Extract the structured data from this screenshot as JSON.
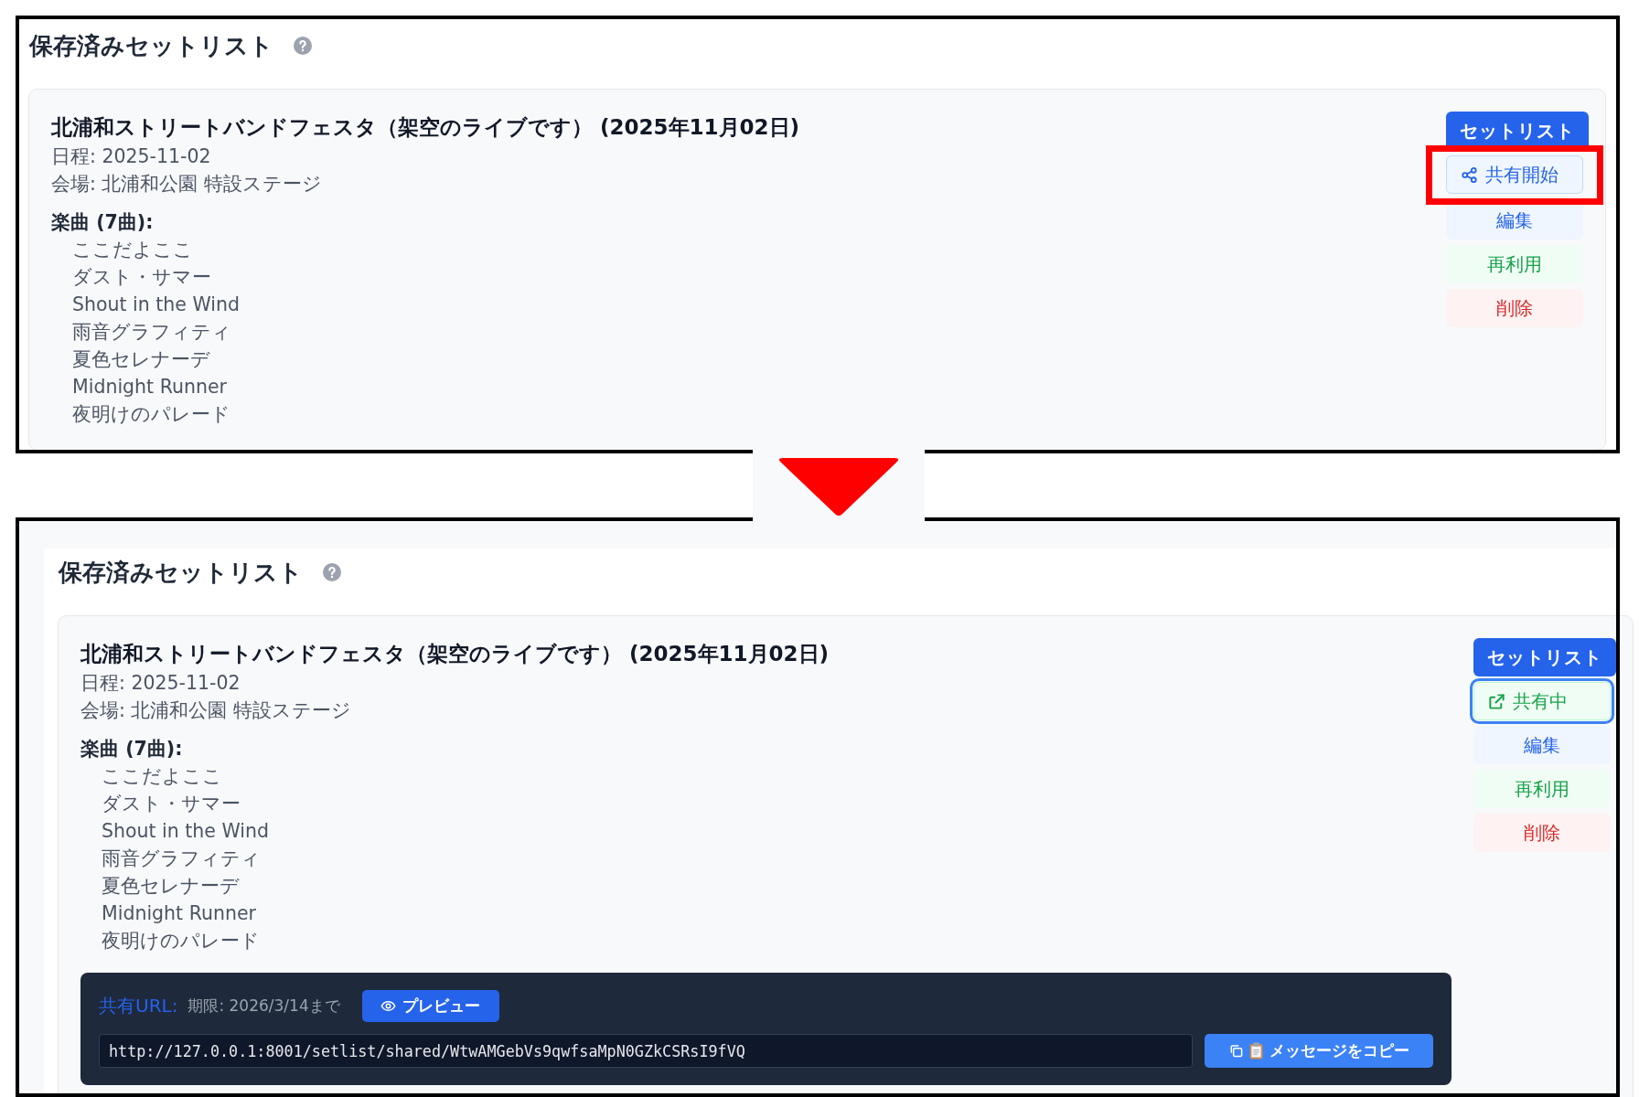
{
  "screens": [
    {
      "kind": "before",
      "heading": "保存済みセットリスト",
      "setlist": {
        "title": "北浦和ストリートバンドフェスタ（架空のライブです） (2025年11月02日)",
        "date": "日程: 2025-11-02",
        "venue": "会場: 北浦和公園 特設ステージ",
        "songs_label": "楽曲 (7曲):",
        "songs": [
          "ここだよここ",
          "ダスト・サマー",
          "Shout in the Wind",
          "雨音グラフィティ",
          "夏色セレナーデ",
          "Midnight Runner",
          "夜明けのパレード"
        ]
      },
      "actions": [
        {
          "kind": "setlist",
          "label": "セットリスト",
          "focused": false,
          "highlighted": false
        },
        {
          "kind": "share",
          "label": "共有開始",
          "sharing": false,
          "focused": false,
          "highlighted": true
        },
        {
          "kind": "edit",
          "label": "編集",
          "focused": false,
          "highlighted": false
        },
        {
          "kind": "reuse",
          "label": "再利用",
          "focused": false,
          "highlighted": false
        },
        {
          "kind": "delete",
          "label": "削除",
          "focused": false,
          "highlighted": false
        }
      ]
    },
    {
      "kind": "after",
      "heading": "保存済みセットリスト",
      "setlist": {
        "title": "北浦和ストリートバンドフェスタ（架空のライブです） (2025年11月02日)",
        "date": "日程: 2025-11-02",
        "venue": "会場: 北浦和公園 特設ステージ",
        "songs_label": "楽曲 (7曲):",
        "songs": [
          "ここだよここ",
          "ダスト・サマー",
          "Shout in the Wind",
          "雨音グラフィティ",
          "夏色セレナーデ",
          "Midnight Runner",
          "夜明けのパレード"
        ]
      },
      "actions": [
        {
          "kind": "setlist",
          "label": "セットリスト",
          "focused": false,
          "highlighted": false
        },
        {
          "kind": "share",
          "label": "共有中",
          "sharing": true,
          "focused": true,
          "highlighted": false
        },
        {
          "kind": "edit",
          "label": "編集",
          "focused": false,
          "highlighted": false
        },
        {
          "kind": "reuse",
          "label": "再利用",
          "focused": false,
          "highlighted": false
        },
        {
          "kind": "delete",
          "label": "削除",
          "focused": false,
          "highlighted": false
        }
      ],
      "share_panel": {
        "url_label": "共有URL:",
        "expiry": "期限: 2026/3/14まで",
        "preview_button": "プレビュー",
        "url": "http://127.0.0.1:8001/setlist/shared/WtwAMGebVs9qwfsaMpN0GZkCSRsI9fVQ",
        "copy_button": "メッセージをコピー"
      }
    }
  ]
}
